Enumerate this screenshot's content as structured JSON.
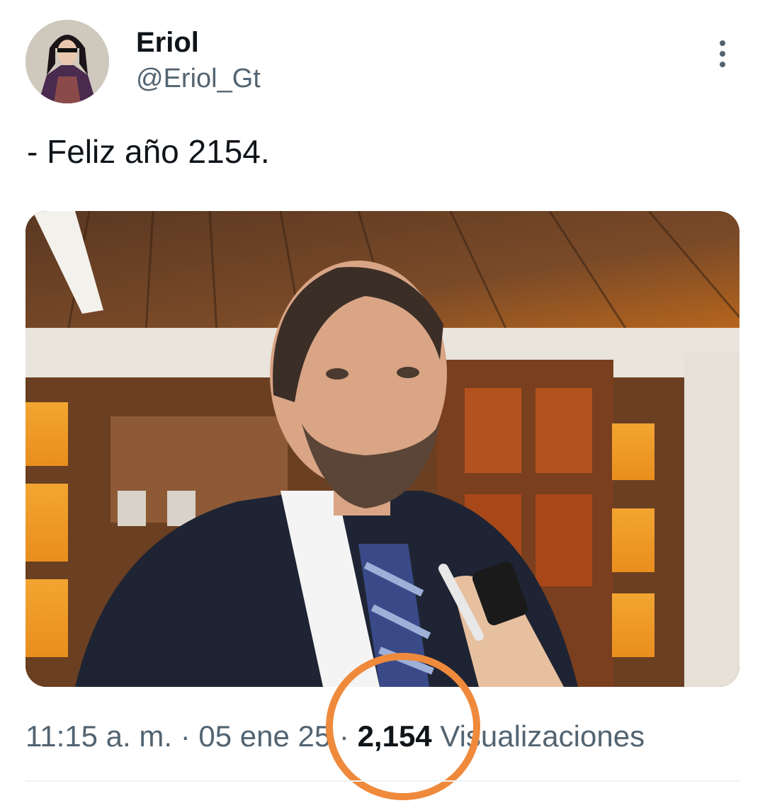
{
  "author": {
    "display_name": "Eriol",
    "handle": "@Eriol_Gt"
  },
  "tweet": {
    "text": "- Feliz año 2154."
  },
  "meta": {
    "time": "11:15 a. m.",
    "separator": "·",
    "date": "05 ene 25",
    "views_count": "2,154",
    "views_label": "Visualizaciones"
  },
  "icons": {
    "more": "more-vertical-icon"
  },
  "colors": {
    "highlight": "#ef8a3c",
    "secondary_text": "#536471",
    "primary_text": "#0f1419"
  }
}
